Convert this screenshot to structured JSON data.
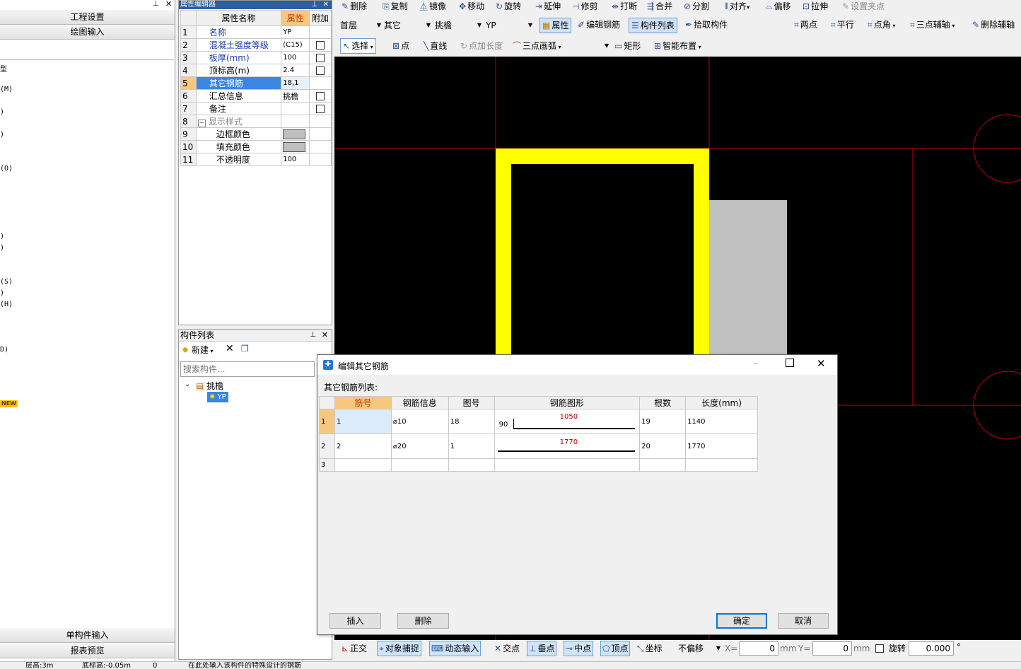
{
  "left_panel": {
    "top_tabs": [
      "工程设置",
      "绘图输入"
    ],
    "truncated_items": [
      "型",
      "(M)",
      ")",
      ")",
      "(O)",
      ")",
      ")",
      "(S)",
      ")",
      "(H)",
      "D)"
    ],
    "new_badge": "NEW",
    "bottom_tabs": [
      "单构件输入",
      "报表预览"
    ]
  },
  "property_editor": {
    "title": "属性编辑器",
    "headers": {
      "name": "属性名称",
      "value": "属性",
      "extra": "附加"
    },
    "rows": [
      {
        "n": "1",
        "name": "名称",
        "value": "YP"
      },
      {
        "n": "2",
        "name": "混凝土强度等级",
        "value": "(C15)"
      },
      {
        "n": "3",
        "name": "板厚(mm)",
        "value": "100"
      },
      {
        "n": "4",
        "name": "顶标高(m)",
        "value": "2.4"
      },
      {
        "n": "5",
        "name": "其它钢筋",
        "value": "18,1"
      },
      {
        "n": "6",
        "name": "汇总信息",
        "value": "挑檐"
      },
      {
        "n": "7",
        "name": "备注",
        "value": ""
      },
      {
        "n": "8",
        "name": "显示样式",
        "value": ""
      },
      {
        "n": "9",
        "name": "边框颜色",
        "value": ""
      },
      {
        "n": "10",
        "name": "填充颜色",
        "value": ""
      },
      {
        "n": "11",
        "name": "不透明度",
        "value": "100"
      }
    ],
    "collapse_symbol": "−"
  },
  "component_list": {
    "title": "构件列表",
    "new_label": "新建",
    "search_placeholder": "搜索构件...",
    "tree_root": "挑檐",
    "tree_child": "YP"
  },
  "toolbar_top": [
    "删除",
    "复制",
    "镜像",
    "移动",
    "旋转",
    "延伸",
    "修剪",
    "打断",
    "合并",
    "分割",
    "对齐",
    "偏移",
    "拉伸",
    "设置夹点"
  ],
  "toolbar_mid": {
    "combos": [
      "首层",
      "其它",
      "挑檐",
      "YP"
    ],
    "buttons": [
      "属性",
      "编辑钢筋",
      "构件列表",
      "拾取构件"
    ],
    "right": [
      "两点",
      "平行",
      "点角",
      "三点辅轴",
      "删除辅轴"
    ]
  },
  "toolbar_draw": [
    "选择",
    "点",
    "直线",
    "点加长度",
    "三点画弧",
    "矩形",
    "智能布置"
  ],
  "dialog": {
    "title": "编辑其它钢筋",
    "list_label": "其它钢筋列表:",
    "columns": [
      "筋号",
      "钢筋信息",
      "图号",
      "钢筋图形",
      "根数",
      "长度(mm)"
    ],
    "rows": [
      {
        "n": "1",
        "bar_no": "1",
        "info": "⌀10",
        "shape_no": "18",
        "hook": "90",
        "dim": "1050",
        "count": "19",
        "length": "1140"
      },
      {
        "n": "2",
        "bar_no": "2",
        "info": "⌀20",
        "shape_no": "1",
        "hook": "",
        "dim": "1770",
        "count": "20",
        "length": "1770"
      },
      {
        "n": "3",
        "bar_no": "",
        "info": "",
        "shape_no": "",
        "hook": "",
        "dim": "",
        "count": "",
        "length": ""
      }
    ],
    "btn_insert": "插入",
    "btn_delete": "删除",
    "btn_ok": "确定",
    "btn_cancel": "取消"
  },
  "status_bar": {
    "snap_buttons": [
      "正交",
      "对象捕捉",
      "动态输入",
      "交点",
      "垂点",
      "中点",
      "顶点",
      "坐标"
    ],
    "offset_mode": "不偏移",
    "x_label": "X=",
    "x_value": "0",
    "y_label": "Y=",
    "y_value": "0",
    "unit": "mm",
    "rotate_label": "旋转",
    "rotate_value": "0.000",
    "degree": "°",
    "footer_items": [
      "层高:3m",
      "底标高:-0.05m",
      "0",
      "在此处输入该构件的特殊设计的钢筋"
    ]
  },
  "colors": {
    "canvas_bg": "#000000",
    "slab_outline": "#ffff00",
    "axis_line": "#c00000",
    "fill_gray": "#c0c0c0",
    "selection_blue": "#3a86e0",
    "header_orange": "#f7c780",
    "dim_text": "#c00000"
  }
}
